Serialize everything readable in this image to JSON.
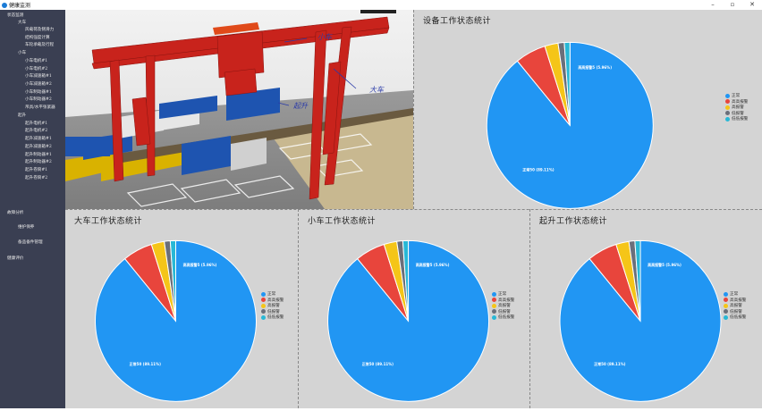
{
  "window": {
    "title": "健康监测",
    "minimize": "–",
    "maximize": "▫",
    "close": "✕"
  },
  "sidebar": {
    "items": [
      {
        "label": "状态监测",
        "indent": 0
      },
      {
        "label": "大车",
        "indent": 1
      },
      {
        "label": "风载荷及侧滑力",
        "indent": 2
      },
      {
        "label": "结构强度计算",
        "indent": 2
      },
      {
        "label": "车轮承载及行程",
        "indent": 2
      },
      {
        "label": "小车",
        "indent": 1
      },
      {
        "label": "小车电机#1",
        "indent": 2
      },
      {
        "label": "小车电机#2",
        "indent": 2
      },
      {
        "label": "小车减速箱#1",
        "indent": 2
      },
      {
        "label": "小车减速箱#2",
        "indent": 2
      },
      {
        "label": "小车制动器#1",
        "indent": 2
      },
      {
        "label": "小车制动器#2",
        "indent": 2
      },
      {
        "label": "吊具/水平张紧器",
        "indent": 2
      },
      {
        "label": "起升",
        "indent": 1
      },
      {
        "label": "起升电机#1",
        "indent": 2
      },
      {
        "label": "起升电机#2",
        "indent": 2
      },
      {
        "label": "起升减速箱#1",
        "indent": 2
      },
      {
        "label": "起升减速箱#2",
        "indent": 2
      },
      {
        "label": "起升制动器#1",
        "indent": 2
      },
      {
        "label": "起升制动器#2",
        "indent": 2
      },
      {
        "label": "起升卷筒#1",
        "indent": 2
      },
      {
        "label": "起升卷筒#2",
        "indent": 2
      },
      {
        "label": "故障分析",
        "indent": 0
      },
      {
        "label": "维护保养",
        "indent": 1
      },
      {
        "label": "备品备件管理",
        "indent": 1
      },
      {
        "label": "健康评价",
        "indent": 0
      }
    ]
  },
  "scene": {
    "label_trolley": "小车",
    "label_gantry": "大车",
    "label_hoist": "起升"
  },
  "panels": {
    "device": {
      "title": "设备工作状态统计"
    },
    "gantry": {
      "title": "大车工作状态统计"
    },
    "trolley": {
      "title": "小车工作状态统计"
    },
    "hoist": {
      "title": "起升工作状态统计"
    }
  },
  "legend": [
    "正常",
    "高高报警",
    "高报警",
    "低报警",
    "低低报警"
  ],
  "colors": {
    "normal": "#2196f3",
    "high_high": "#e8453c",
    "high": "#f5c518",
    "low": "#6b6f7a",
    "low_low": "#28b8d6"
  },
  "chart_data": [
    {
      "type": "pie",
      "title": "设备工作状态统计",
      "categories": [
        "正常",
        "高高报警",
        "高报警",
        "低报警",
        "低低报警"
      ],
      "values": [
        89.11,
        6.0,
        2.6,
        1.2,
        1.09
      ],
      "slice_labels": [
        "正常50 (89.11%)",
        "高高报警5 (5.96%)",
        "",
        "",
        ""
      ]
    },
    {
      "type": "pie",
      "title": "大车工作状态统计",
      "categories": [
        "正常",
        "高高报警",
        "高报警",
        "低报警",
        "低低报警"
      ],
      "values": [
        89.11,
        6.0,
        2.6,
        1.2,
        1.09
      ],
      "slice_labels": [
        "正常50 (89.11%)",
        "高高报警5 (5.96%)",
        "",
        "",
        ""
      ]
    },
    {
      "type": "pie",
      "title": "小车工作状态统计",
      "categories": [
        "正常",
        "高高报警",
        "高报警",
        "低报警",
        "低低报警"
      ],
      "values": [
        89.11,
        6.0,
        2.6,
        1.2,
        1.09
      ],
      "slice_labels": [
        "正常50 (89.11%)",
        "高高报警5 (5.96%)",
        "",
        "",
        ""
      ]
    },
    {
      "type": "pie",
      "title": "起升工作状态统计",
      "categories": [
        "正常",
        "高高报警",
        "高报警",
        "低报警",
        "低低报警"
      ],
      "values": [
        89.11,
        6.0,
        2.6,
        1.2,
        1.09
      ],
      "slice_labels": [
        "正常50 (89.11%)",
        "高高报警5 (5.96%)",
        "",
        "",
        ""
      ]
    }
  ]
}
